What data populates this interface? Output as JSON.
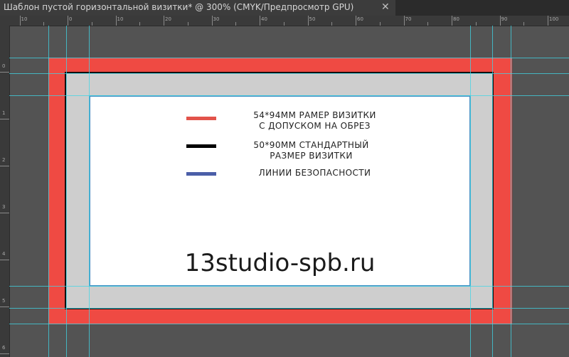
{
  "window": {
    "tab_title": "Шаблон пустой горизонтальной визитки* @ 300% (CMYK/Предпросмотр GPU)",
    "close_glyph": "✕"
  },
  "ruler": {
    "horizontal_labels": [
      "10",
      "0",
      "10",
      "20",
      "30",
      "40",
      "50",
      "60",
      "70",
      "80",
      "90",
      "100"
    ],
    "vertical_labels": [
      "0",
      "1",
      "2",
      "3",
      "4",
      "5",
      "6"
    ]
  },
  "canvas": {
    "colors": {
      "bleed": "#ef4a43",
      "trim": "#111111",
      "safe": "#4a8fc3",
      "guides": "#3fd6e6"
    },
    "legend": [
      {
        "color": "#e2534a",
        "line1": "54*94ММ РАМЕР ВИЗИТКИ",
        "line2": "С ДОПУСКОМ НА ОБРЕЗ"
      },
      {
        "color": "#000000",
        "line1": "50*90ММ  СТАНДАРТНЫЙ",
        "line2": "РАЗМЕР ВИЗИТКИ"
      },
      {
        "color": "#4b5fa8",
        "line1": "ЛИНИИ БЕЗОПАСНОСТИ",
        "line2": ""
      }
    ],
    "website": "13studio-spb.ru"
  }
}
